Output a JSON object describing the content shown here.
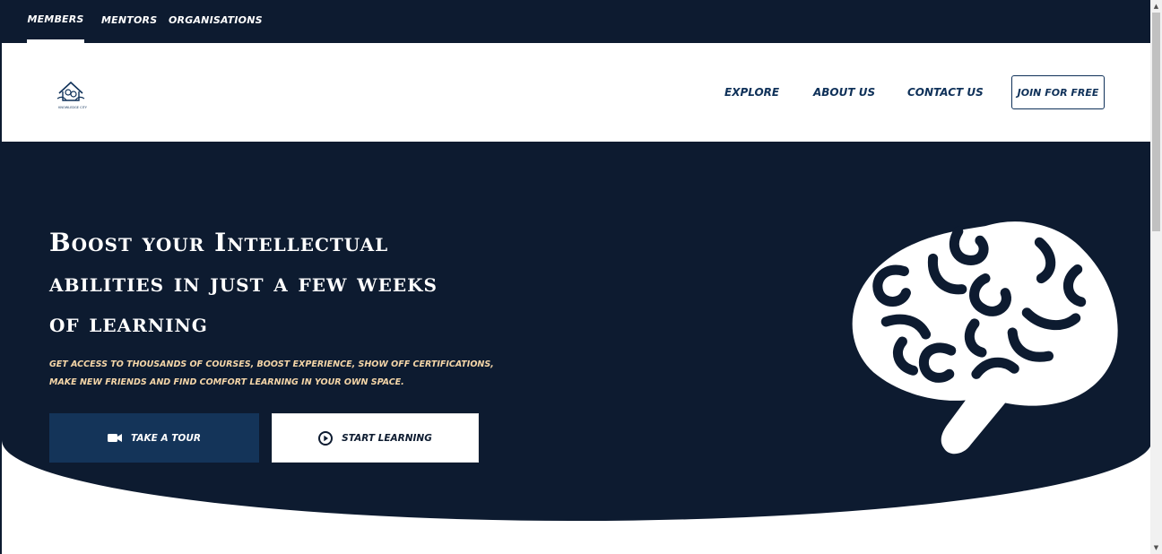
{
  "audience_tabs": [
    {
      "label": "Members",
      "active": true
    },
    {
      "label": "Mentors",
      "active": false
    },
    {
      "label": "Organisations",
      "active": false
    }
  ],
  "header": {
    "logo_icon": "brain-house-logo",
    "logo_caption": "KNOWLEDGE CITY",
    "nav": [
      {
        "label": "Explore"
      },
      {
        "label": "About Us"
      },
      {
        "label": "Contact Us"
      }
    ],
    "join_label": "Join for free"
  },
  "hero": {
    "title_line1": "Boost your Intellectual",
    "title_line2": "abilities in just a few weeks",
    "title_line3": "of learning",
    "subtitle": "Get access to thousands of courses, boost experience, show off certifications, make new friends and find comfort learning in your own space.",
    "tour_label": "Take a tour",
    "tour_icon": "video-camera-icon",
    "learn_label": "Start learning",
    "learn_icon": "play-circle-icon",
    "illustration": "brain-icon"
  },
  "colors": {
    "navy": "#0d1b30",
    "button_blue": "#143459",
    "link_blue": "#0f3159",
    "subtitle_cream": "#f5d6a8",
    "white": "#ffffff"
  }
}
